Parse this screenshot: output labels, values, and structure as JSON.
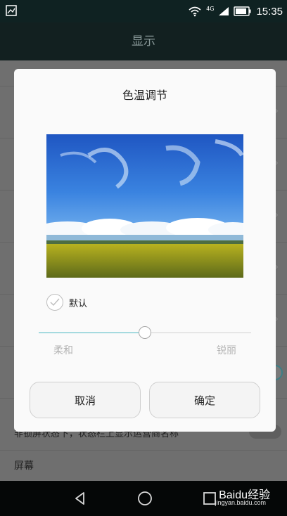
{
  "status_bar": {
    "time": "15:35",
    "network": "4G",
    "icons": [
      "gallery-icon",
      "wifi-icon",
      "signal-icon",
      "battery-icon"
    ]
  },
  "app_bar": {
    "title": "显示"
  },
  "background": {
    "row_caption": "非锁屏状态下，状态栏上显示运营商名称",
    "row_header": "屏幕"
  },
  "dialog": {
    "title": "色温调节",
    "preview_image": "landscape-sky-field",
    "default_checkbox": {
      "label": "默认",
      "checked": false
    },
    "slider": {
      "min_label": "柔和",
      "max_label": "锐丽",
      "value": 0.5
    },
    "buttons": {
      "cancel": "取消",
      "ok": "确定"
    }
  },
  "nav_bar": {
    "icons": [
      "back-icon",
      "home-icon",
      "recents-icon"
    ]
  },
  "watermark": {
    "text": "Baidu经验",
    "sub": "jingyan.baidu.com"
  },
  "colors": {
    "accent": "#47b6c2",
    "status_bar": "#0f2222",
    "dialog_bg": "#fafafa"
  }
}
